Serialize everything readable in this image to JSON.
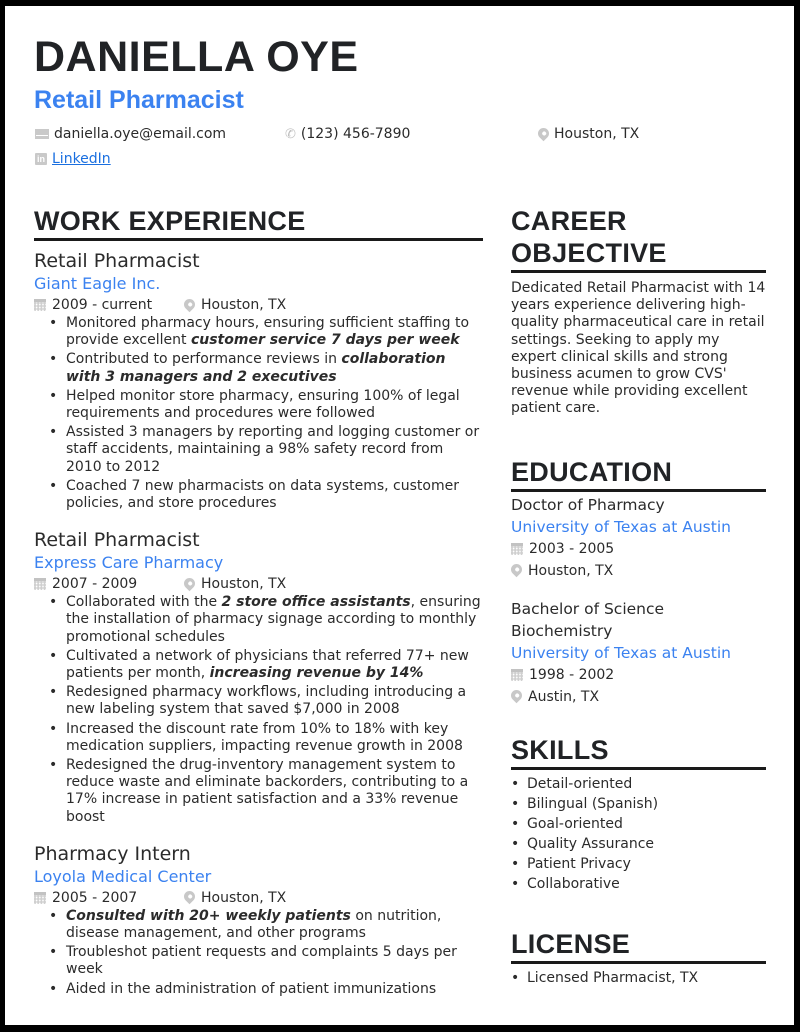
{
  "header": {
    "name": "DANIELLA OYE",
    "title": "Retail Pharmacist",
    "email": "daniella.oye@email.com",
    "phone": "(123) 456-7890",
    "location": "Houston, TX",
    "linkedin_label": "LinkedIn",
    "icons": {
      "email": "envelope-icon",
      "phone": "phone-icon",
      "location": "map-pin-icon",
      "linkedin": "linkedin-icon"
    }
  },
  "colors": {
    "accent": "#3b82f0",
    "heading": "#212326",
    "text": "#2b2b2b",
    "icon": "#c9c9c9",
    "border": "#000000"
  },
  "work": {
    "heading": "WORK EXPERIENCE",
    "jobs": [
      {
        "title": "Retail Pharmacist",
        "company": "Giant Eagle Inc.",
        "dates": "2009 - current",
        "location": "Houston, TX",
        "bullets": [
          {
            "pre": "Monitored pharmacy hours, ensuring sufficient staffing to provide excellent ",
            "em": "customer service 7 days per week",
            "post": ""
          },
          {
            "pre": "Contributed to performance reviews in ",
            "em": "collaboration with 3 managers and 2 executives",
            "post": ""
          },
          {
            "pre": "Helped monitor store pharmacy, ensuring 100% of legal requirements and procedures were followed",
            "em": "",
            "post": ""
          },
          {
            "pre": "Assisted 3 managers by reporting and logging customer or staff accidents, maintaining a 98% safety record from 2010 to 2012",
            "em": "",
            "post": ""
          },
          {
            "pre": "Coached 7 new pharmacists on data systems, customer policies, and store procedures",
            "em": "",
            "post": ""
          }
        ]
      },
      {
        "title": "Retail Pharmacist",
        "company": "Express Care Pharmacy",
        "dates": "2007 - 2009",
        "location": "Houston, TX",
        "bullets": [
          {
            "pre": "Collaborated with the ",
            "em": "2 store office assistants",
            "post": ", ensuring the installation of pharmacy signage according to monthly promotional schedules"
          },
          {
            "pre": "Cultivated a network of physicians that referred 77+ new patients per month, ",
            "em": "increasing revenue by 14%",
            "post": ""
          },
          {
            "pre": "Redesigned pharmacy workflows, including introducing a new labeling system that saved $7,000 in 2008",
            "em": "",
            "post": ""
          },
          {
            "pre": "Increased the discount rate from 10% to 18% with key medication suppliers, impacting revenue growth in 2008",
            "em": "",
            "post": ""
          },
          {
            "pre": "Redesigned the drug-inventory management system to reduce waste and eliminate backorders, contributing to a 17% increase in patient satisfaction and a 33% revenue boost",
            "em": "",
            "post": ""
          }
        ]
      },
      {
        "title": "Pharmacy Intern",
        "company": "Loyola Medical Center",
        "dates": "2005 - 2007",
        "location": "Houston, TX",
        "bullets": [
          {
            "pre": "",
            "em": "Consulted with 20+ weekly patients",
            "post": " on nutrition, disease management, and other programs"
          },
          {
            "pre": "Troubleshot patient requests and complaints 5 days per week",
            "em": "",
            "post": ""
          },
          {
            "pre": "Aided in the administration of patient immunizations",
            "em": "",
            "post": ""
          }
        ]
      }
    ]
  },
  "objective": {
    "heading_line1": "CAREER",
    "heading_line2": "OBJECTIVE",
    "text": "Dedicated Retail Pharmacist with 14 years experience delivering high-quality pharmaceutical care in retail settings. Seeking to apply my expert clinical skills and strong business acumen to grow CVS' revenue while providing excellent patient care."
  },
  "education": {
    "heading": "EDUCATION",
    "items": [
      {
        "degree": "Doctor of Pharmacy",
        "school": "University of Texas at Austin",
        "dates": "2003 - 2005",
        "location": "Houston, TX"
      },
      {
        "degree": "Bachelor of Science Biochemistry",
        "school": "University of Texas at Austin",
        "dates": "1998 - 2002",
        "location": "Austin, TX"
      }
    ]
  },
  "skills": {
    "heading": "SKILLS",
    "items": [
      "Detail-oriented",
      "Bilingual (Spanish)",
      "Goal-oriented",
      "Quality Assurance",
      "Patient Privacy",
      "Collaborative"
    ]
  },
  "license": {
    "heading": "LICENSE",
    "items": [
      "Licensed Pharmacist, TX"
    ]
  }
}
